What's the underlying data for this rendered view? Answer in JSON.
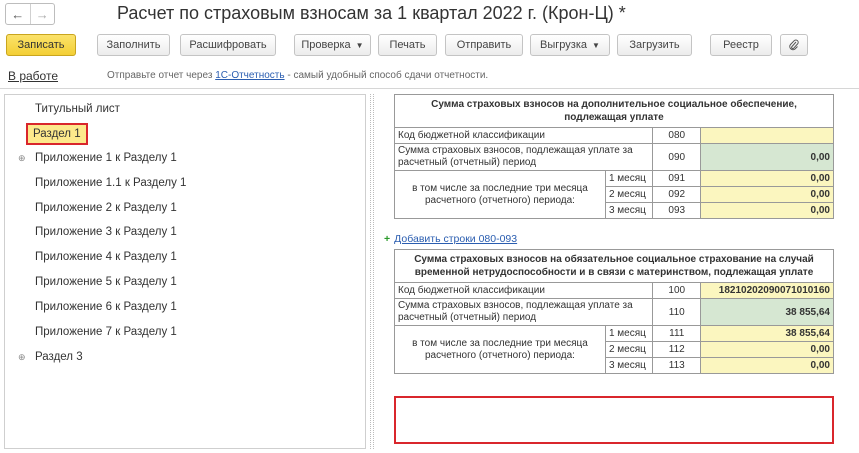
{
  "window": {
    "title": "Расчет по страховым взносам за 1 квартал 2022 г. (Крон-Ц) *",
    "nav_back": "←",
    "nav_forward": "→"
  },
  "toolbar": {
    "record": "Записать",
    "fill": "Заполнить",
    "decode": "Расшифровать",
    "check": "Проверка",
    "print": "Печать",
    "send": "Отправить",
    "export": "Выгрузка",
    "load": "Загрузить",
    "registry": "Реестр",
    "attach_icon": "paperclip-icon"
  },
  "info": {
    "status": "В работе",
    "text_before": "Отправьте отчет через ",
    "link": "1С-Отчетность",
    "text_after": " - самый удобный способ сдачи отчетности."
  },
  "sections": [
    {
      "label": "Титульный лист",
      "expandable": false,
      "selected": false
    },
    {
      "label": "Раздел 1",
      "expandable": false,
      "selected": true
    },
    {
      "label": "Приложение 1 к Разделу 1",
      "expandable": true,
      "selected": false
    },
    {
      "label": "Приложение 1.1 к Разделу 1",
      "expandable": false,
      "selected": false
    },
    {
      "label": "Приложение 2 к Разделу 1",
      "expandable": false,
      "selected": false
    },
    {
      "label": "Приложение 3 к Разделу 1",
      "expandable": false,
      "selected": false
    },
    {
      "label": "Приложение 4 к Разделу 1",
      "expandable": false,
      "selected": false
    },
    {
      "label": "Приложение 5 к Разделу 1",
      "expandable": false,
      "selected": false
    },
    {
      "label": "Приложение 6 к Разделу 1",
      "expandable": false,
      "selected": false
    },
    {
      "label": "Приложение 7 к Разделу 1",
      "expandable": false,
      "selected": false
    },
    {
      "label": "Раздел 3",
      "expandable": true,
      "selected": false
    }
  ],
  "expand_icon": "⊕",
  "form": {
    "block1": {
      "header": "Сумма страховых взносов на дополнительное социальное обеспечение, подлежащая уплате",
      "kbk_label": "Код бюджетной классификации",
      "kbk_code": "080",
      "kbk_value": "",
      "sum_label": "Сумма страховых взносов, подлежащая уплате за расчетный (отчетный) период",
      "sum_code": "090",
      "sum_value": "0,00",
      "months_label": "в том числе за последние три месяца расчетного (отчетного) периода:",
      "months": [
        {
          "label": "1 месяц",
          "code": "091",
          "value": "0,00"
        },
        {
          "label": "2 месяц",
          "code": "092",
          "value": "0,00"
        },
        {
          "label": "3 месяц",
          "code": "093",
          "value": "0,00"
        }
      ]
    },
    "add_rows": "Добавить строки 080-093",
    "block2": {
      "header": "Сумма страховых взносов на обязательное социальное страхование на случай временной нетрудоспособности и в связи с материнством, подлежащая уплате",
      "kbk_label": "Код бюджетной классификации",
      "kbk_code": "100",
      "kbk_value": "18210202090071010160",
      "sum_label": "Сумма страховых взносов, подлежащая уплате за расчетный (отчетный) период",
      "sum_code": "110",
      "sum_value": "38 855,64",
      "months_label": "в том числе за последние три месяца расчетного (отчетного) периода:",
      "months": [
        {
          "label": "1 месяц",
          "code": "111",
          "value": "38 855,64"
        },
        {
          "label": "2 месяц",
          "code": "112",
          "value": "0,00"
        },
        {
          "label": "3 месяц",
          "code": "113",
          "value": "0,00"
        }
      ]
    }
  },
  "colors": {
    "accent_yellow": "#f3cf35",
    "highlight_red": "#d9262c",
    "cell_yellow": "#fbf6bf",
    "cell_green": "#d6e7d2",
    "link_blue": "#2a5db0"
  }
}
